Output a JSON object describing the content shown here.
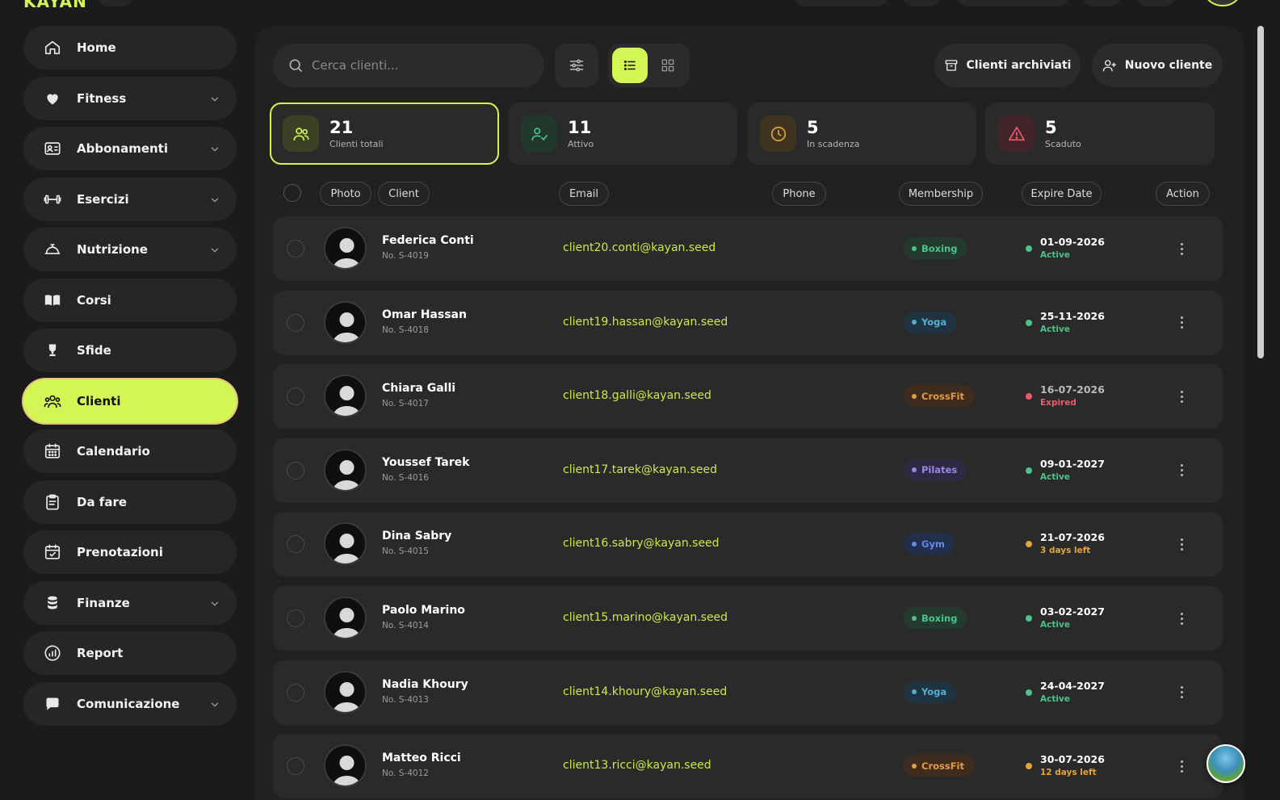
{
  "app": {
    "logo": "KAYAN"
  },
  "sidebar": {
    "items": [
      {
        "label": "Home",
        "icon": "home-icon",
        "has_chevron": false
      },
      {
        "label": "Fitness",
        "icon": "heart-icon",
        "has_chevron": true
      },
      {
        "label": "Abbonamenti",
        "icon": "id-card-icon",
        "has_chevron": true
      },
      {
        "label": "Esercizi",
        "icon": "dumbbell-icon",
        "has_chevron": true
      },
      {
        "label": "Nutrizione",
        "icon": "cloche-icon",
        "has_chevron": true
      },
      {
        "label": "Corsi",
        "icon": "book-icon",
        "has_chevron": false
      },
      {
        "label": "Sfide",
        "icon": "trophy-icon",
        "has_chevron": false
      },
      {
        "label": "Clienti",
        "icon": "users-icon",
        "has_chevron": false,
        "active": true
      },
      {
        "label": "Calendario",
        "icon": "calendar-icon",
        "has_chevron": false
      },
      {
        "label": "Da fare",
        "icon": "clipboard-icon",
        "has_chevron": false
      },
      {
        "label": "Prenotazioni",
        "icon": "calendar-check-icon",
        "has_chevron": false
      },
      {
        "label": "Finanze",
        "icon": "coins-icon",
        "has_chevron": true
      },
      {
        "label": "Report",
        "icon": "report-icon",
        "has_chevron": false
      },
      {
        "label": "Comunicazione",
        "icon": "chat-icon",
        "has_chevron": true
      }
    ]
  },
  "toolbar": {
    "search_placeholder": "Cerca clienti...",
    "archived_label": "Clienti archiviati",
    "new_client_label": "Nuovo cliente"
  },
  "stats": [
    {
      "value": "21",
      "label": "Clienti totali",
      "color": "#d4f556",
      "bg": "#3b4125"
    },
    {
      "value": "11",
      "label": "Attivo",
      "color": "#4cc38a",
      "bg": "#23382d"
    },
    {
      "value": "5",
      "label": "In scadenza",
      "color": "#e2a53d",
      "bg": "#3f3420"
    },
    {
      "value": "5",
      "label": "Scaduto",
      "color": "#ef5a6a",
      "bg": "#42252a"
    }
  ],
  "columns": {
    "photo": "Photo",
    "client": "Client",
    "email": "Email",
    "phone": "Phone",
    "membership": "Membership",
    "expire": "Expire Date",
    "action": "Action"
  },
  "clients": [
    {
      "name": "Federica Conti",
      "number": "No. S-4019",
      "email": "client20.conti@kayan.seed",
      "membership": "Boxing",
      "expire": "01-09-2026",
      "status": "Active",
      "status_type": "active"
    },
    {
      "name": "Omar Hassan",
      "number": "No. S-4018",
      "email": "client19.hassan@kayan.seed",
      "membership": "Yoga",
      "expire": "25-11-2026",
      "status": "Active",
      "status_type": "active"
    },
    {
      "name": "Chiara Galli",
      "number": "No. S-4017",
      "email": "client18.galli@kayan.seed",
      "membership": "CrossFit",
      "expire": "16-07-2026",
      "status": "Expired",
      "status_type": "expired"
    },
    {
      "name": "Youssef Tarek",
      "number": "No. S-4016",
      "email": "client17.tarek@kayan.seed",
      "membership": "Pilates",
      "expire": "09-01-2027",
      "status": "Active",
      "status_type": "active"
    },
    {
      "name": "Dina Sabry",
      "number": "No. S-4015",
      "email": "client16.sabry@kayan.seed",
      "membership": "Gym",
      "expire": "21-07-2026",
      "status": "3 days left",
      "status_type": "soon"
    },
    {
      "name": "Paolo Marino",
      "number": "No. S-4014",
      "email": "client15.marino@kayan.seed",
      "membership": "Boxing",
      "expire": "03-02-2027",
      "status": "Active",
      "status_type": "active"
    },
    {
      "name": "Nadia Khoury",
      "number": "No. S-4013",
      "email": "client14.khoury@kayan.seed",
      "membership": "Yoga",
      "expire": "24-04-2027",
      "status": "Active",
      "status_type": "active"
    },
    {
      "name": "Matteo Ricci",
      "number": "No. S-4012",
      "email": "client13.ricci@kayan.seed",
      "membership": "CrossFit",
      "expire": "30-07-2026",
      "status": "12 days left",
      "status_type": "soon"
    }
  ],
  "membership_colors": {
    "Boxing": {
      "fg": "#4cc38a",
      "bg": "#233a2e"
    },
    "Yoga": {
      "fg": "#4fb0d6",
      "bg": "#1f3440"
    },
    "CrossFit": {
      "fg": "#e79a45",
      "bg": "#3e2d1e"
    },
    "Pilates": {
      "fg": "#9b86e6",
      "bg": "#2f2a44"
    },
    "Gym": {
      "fg": "#5f8cf0",
      "bg": "#222e4a"
    }
  },
  "status_colors": {
    "active": "#4cc38a",
    "expired": "#ef5a6a",
    "soon": "#e2a53d"
  }
}
